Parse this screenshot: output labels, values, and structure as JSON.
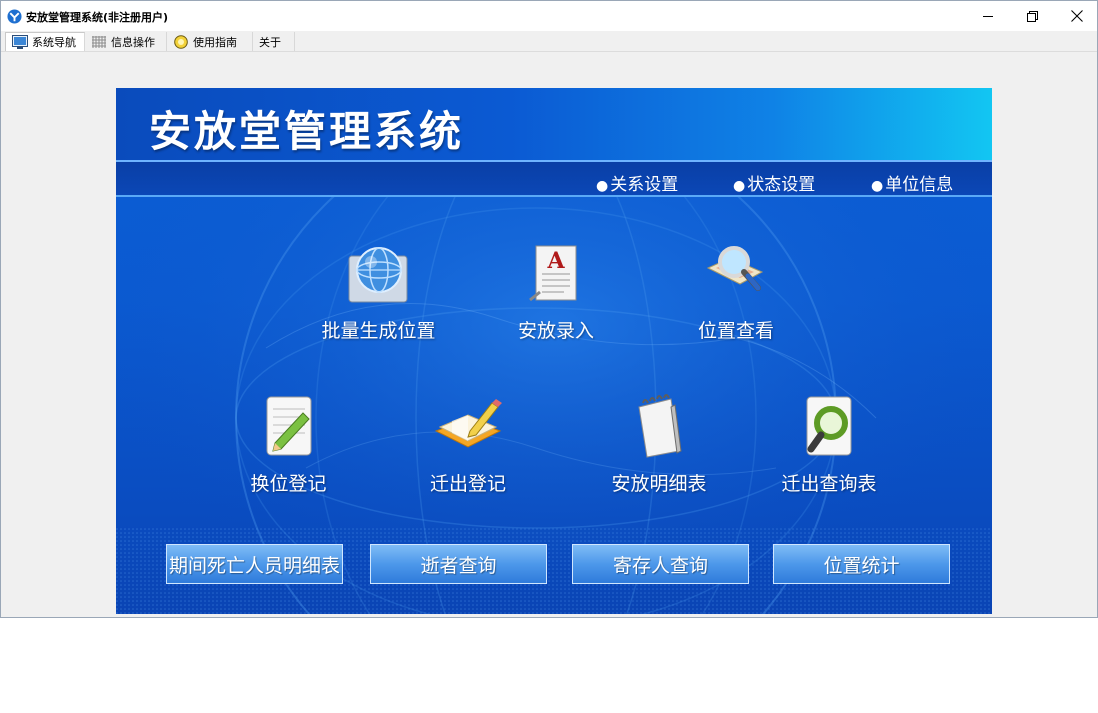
{
  "window": {
    "title": "安放堂管理系统(非注册用户)",
    "controls": {
      "minimize": "minimize-icon",
      "restore": "restore-icon",
      "close": "close-icon"
    }
  },
  "tabs": [
    {
      "label": "系统导航",
      "icon": "monitor-icon",
      "active": true
    },
    {
      "label": "信息操作",
      "icon": "grid-icon",
      "active": false
    },
    {
      "label": "使用指南",
      "icon": "lightbulb-icon",
      "active": false
    },
    {
      "label": "关于",
      "icon": "",
      "active": false
    }
  ],
  "header": {
    "title": "安放堂管理系统"
  },
  "nav_links": [
    {
      "label": "关系设置"
    },
    {
      "label": "状态设置"
    },
    {
      "label": "单位信息"
    }
  ],
  "bullet": "●",
  "features": [
    {
      "label": "批量生成位置",
      "icon": "globe-icon"
    },
    {
      "label": "安放录入",
      "icon": "document-a-icon"
    },
    {
      "label": "位置查看",
      "icon": "magnifier-map-icon"
    },
    {
      "label": "换位登记",
      "icon": "notepad-pencil-icon"
    },
    {
      "label": "迁出登记",
      "icon": "open-book-pencil-icon"
    },
    {
      "label": "安放明细表",
      "icon": "spiral-notebook-icon"
    },
    {
      "label": "迁出查询表",
      "icon": "search-document-icon"
    }
  ],
  "buttons": [
    {
      "label": "期间死亡人员明细表"
    },
    {
      "label": "逝者查询"
    },
    {
      "label": "寄存人查询"
    },
    {
      "label": "位置统计"
    }
  ],
  "colors": {
    "panel_blue": "#0b5ad1",
    "header_cyan": "#12c6f2",
    "button_blue": "#4d98ea"
  }
}
